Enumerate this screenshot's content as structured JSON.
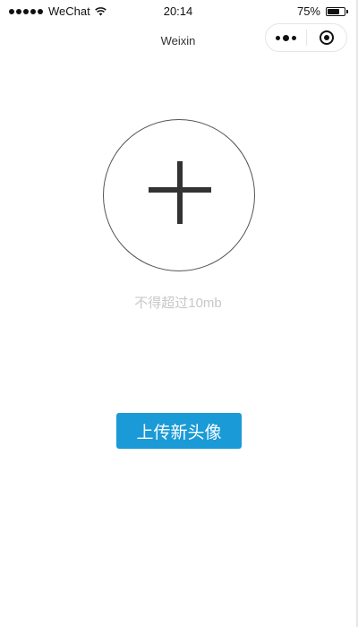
{
  "status_bar": {
    "carrier": "WeChat",
    "time": "20:14",
    "battery_percent": "75%",
    "battery_level": 0.75,
    "signal_icon": "signal-dots-icon",
    "wifi_icon": "wifi-icon",
    "battery_icon": "battery-icon"
  },
  "nav": {
    "title": "Weixin",
    "more_icon": "more-dots-icon",
    "close_icon": "close-ring-icon"
  },
  "upload": {
    "add_icon": "plus-icon",
    "size_hint": "不得超过10mb",
    "button_label": "上传新头像"
  },
  "colors": {
    "button_bg": "#1a9ad6",
    "button_text": "#ffffff",
    "hint_text": "#c8c8c8",
    "plus": "#333333"
  }
}
